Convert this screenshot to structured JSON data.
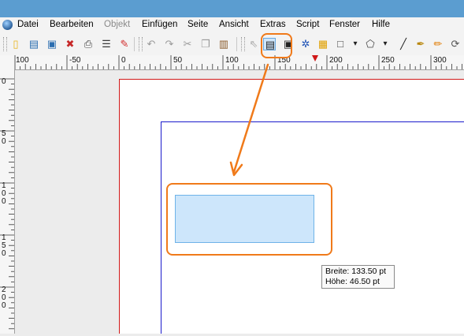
{
  "menu": {
    "items": [
      {
        "label": "Datei",
        "enabled": true
      },
      {
        "label": "Bearbeiten",
        "enabled": true
      },
      {
        "label": "Objekt",
        "enabled": false
      },
      {
        "label": "Einfügen",
        "enabled": true
      },
      {
        "label": "Seite",
        "enabled": true
      },
      {
        "label": "Ansicht",
        "enabled": true
      },
      {
        "label": "Extras",
        "enabled": true
      },
      {
        "label": "Script",
        "enabled": true
      },
      {
        "label": "Fenster",
        "enabled": true
      },
      {
        "label": "Hilfe",
        "enabled": true
      }
    ]
  },
  "toolbar": {
    "tools": [
      {
        "name": "new-document-icon",
        "glyph": "▯",
        "color": "#e8b21a"
      },
      {
        "name": "open-document-icon",
        "glyph": "▤",
        "color": "#2a6db0"
      },
      {
        "name": "save-document-icon",
        "glyph": "▣",
        "color": "#2a6db0"
      },
      {
        "name": "close-document-icon",
        "glyph": "✖",
        "color": "#c62828"
      },
      {
        "name": "print-icon",
        "glyph": "⎙",
        "color": "#444444"
      },
      {
        "name": "preflight-check-icon",
        "glyph": "☰",
        "color": "#3a3a3a"
      },
      {
        "name": "export-pdf-icon",
        "glyph": "✎",
        "color": "#d32f2f"
      },
      {
        "name": "undo-icon",
        "glyph": "↶",
        "color": "#9a9a9a"
      },
      {
        "name": "redo-icon",
        "glyph": "↷",
        "color": "#9a9a9a"
      },
      {
        "name": "cut-icon",
        "glyph": "✂",
        "color": "#9a9a9a"
      },
      {
        "name": "copy-icon",
        "glyph": "❐",
        "color": "#9a9a9a"
      },
      {
        "name": "paste-icon",
        "glyph": "▥",
        "color": "#8a5a2a"
      },
      {
        "name": "select-arrow-icon",
        "glyph": "⇖",
        "color": "#aaaaaa"
      },
      {
        "name": "text-frame-icon",
        "glyph": "▤",
        "color": "#222222",
        "selected": true
      },
      {
        "name": "image-frame-icon",
        "glyph": "▣",
        "color": "#222222"
      },
      {
        "name": "render-frame-icon",
        "glyph": "✲",
        "color": "#1a4fb5"
      },
      {
        "name": "table-icon",
        "glyph": "▦",
        "color": "#e0a000"
      },
      {
        "name": "rectangle-shape-icon",
        "glyph": "□",
        "color": "#444444"
      },
      {
        "name": "shape-dropdown-icon",
        "glyph": "▾",
        "color": "#222222"
      },
      {
        "name": "polygon-icon",
        "glyph": "⬠",
        "color": "#444444"
      },
      {
        "name": "polygon-dropdown-icon",
        "glyph": "▾",
        "color": "#222222"
      },
      {
        "name": "line-icon",
        "glyph": "╱",
        "color": "#222222"
      },
      {
        "name": "bezier-curve-icon",
        "glyph": "✒",
        "color": "#b8860b"
      },
      {
        "name": "freehand-pencil-icon",
        "glyph": "✏",
        "color": "#e07a00"
      },
      {
        "name": "rotate-item-icon",
        "glyph": "⟳",
        "color": "#555555"
      }
    ]
  },
  "ruler": {
    "horizontal_labels": [
      "100",
      "-50",
      "0",
      "50",
      "100",
      "150",
      "200",
      "250",
      "300"
    ],
    "vertical_labels": [
      "0",
      "5 0",
      "1 0 0",
      "1 5 0",
      "2 0 0"
    ]
  },
  "tooltip": {
    "width_text": "Breite: 133.50 pt",
    "height_text": "Höhe: 46.50 pt"
  },
  "colors": {
    "title_bar": "#5b9dd0",
    "highlight": "#f07a1a",
    "page_border": "#d01818",
    "margin_guide": "#1a1acc",
    "frame_fill": "#cde6fb",
    "frame_border": "#6fb3e8"
  }
}
